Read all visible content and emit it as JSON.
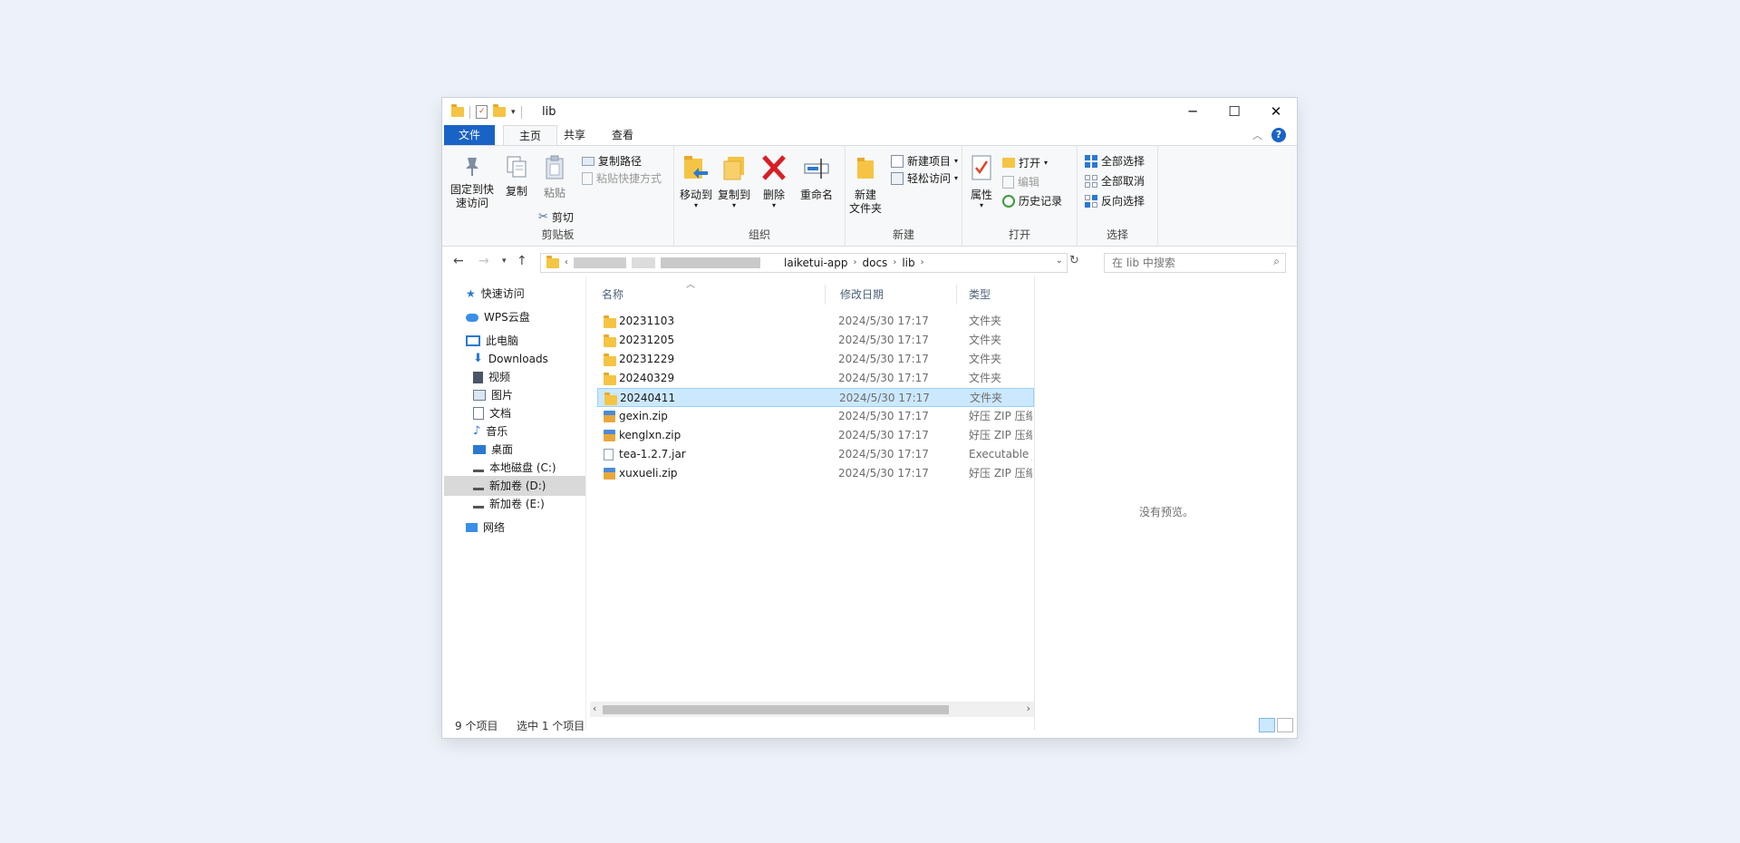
{
  "window": {
    "title": "lib",
    "controls": [
      "minimize",
      "maximize",
      "close"
    ]
  },
  "tabs": {
    "file": "文件",
    "home": "主页",
    "share": "共享",
    "view": "查看"
  },
  "ribbon": {
    "clipboard": {
      "pin_label": "固定到快速访问",
      "copy_label": "复制",
      "paste_label": "粘贴",
      "copy_path_label": "复制路径",
      "paste_shortcut_label": "粘贴快捷方式",
      "cut_label": "剪切",
      "group_label": "剪贴板"
    },
    "organize": {
      "move_to_label": "移动到",
      "copy_to_label": "复制到",
      "delete_label": "删除",
      "rename_label": "重命名",
      "group_label": "组织"
    },
    "new": {
      "new_folder_label": "新建\n文件夹",
      "new_item_label": "新建项目",
      "easy_access_label": "轻松访问",
      "group_label": "新建"
    },
    "open": {
      "properties_label": "属性",
      "open_label": "打开",
      "edit_label": "编辑",
      "history_label": "历史记录",
      "group_label": "打开"
    },
    "select": {
      "select_all_label": "全部选择",
      "select_none_label": "全部取消",
      "invert_label": "反向选择",
      "group_label": "选择"
    }
  },
  "address": {
    "crumbs": [
      "laiketui-app",
      "docs",
      "lib"
    ],
    "search_placeholder": "在 lib 中搜索"
  },
  "nav": {
    "quick_access": "快速访问",
    "wps_cloud": "WPS云盘",
    "this_pc": "此电脑",
    "downloads": "Downloads",
    "videos": "视频",
    "pictures": "图片",
    "documents": "文档",
    "music": "音乐",
    "desktop": "桌面",
    "drive_c": "本地磁盘 (C:)",
    "drive_d": "新加卷 (D:)",
    "drive_e": "新加卷 (E:)",
    "network": "网络"
  },
  "columns": {
    "name": "名称",
    "date": "修改日期",
    "type": "类型"
  },
  "files": [
    {
      "name": "20231103",
      "date": "2024/5/30 17:17",
      "type": "文件夹",
      "kind": "folder"
    },
    {
      "name": "20231205",
      "date": "2024/5/30 17:17",
      "type": "文件夹",
      "kind": "folder"
    },
    {
      "name": "20231229",
      "date": "2024/5/30 17:17",
      "type": "文件夹",
      "kind": "folder"
    },
    {
      "name": "20240329",
      "date": "2024/5/30 17:17",
      "type": "文件夹",
      "kind": "folder"
    },
    {
      "name": "20240411",
      "date": "2024/5/30 17:17",
      "type": "文件夹",
      "kind": "folder"
    },
    {
      "name": "gexin.zip",
      "date": "2024/5/30 17:17",
      "type": "好压 ZIP 压缩文件",
      "kind": "zip"
    },
    {
      "name": "kenglxn.zip",
      "date": "2024/5/30 17:17",
      "type": "好压 ZIP 压缩文件",
      "kind": "zip"
    },
    {
      "name": "tea-1.2.7.jar",
      "date": "2024/5/30 17:17",
      "type": "Executable Jar File",
      "kind": "jar"
    },
    {
      "name": "xuxueli.zip",
      "date": "2024/5/30 17:17",
      "type": "好压 ZIP 压缩文件",
      "kind": "zip"
    }
  ],
  "preview": {
    "empty_text": "没有预览。"
  },
  "status": {
    "item_count": "9 个项目",
    "selected": "选中 1 个项目"
  },
  "colors": {
    "accent": "#1a63c6",
    "selection": "#cce8ff",
    "folder": "#f5c444"
  }
}
